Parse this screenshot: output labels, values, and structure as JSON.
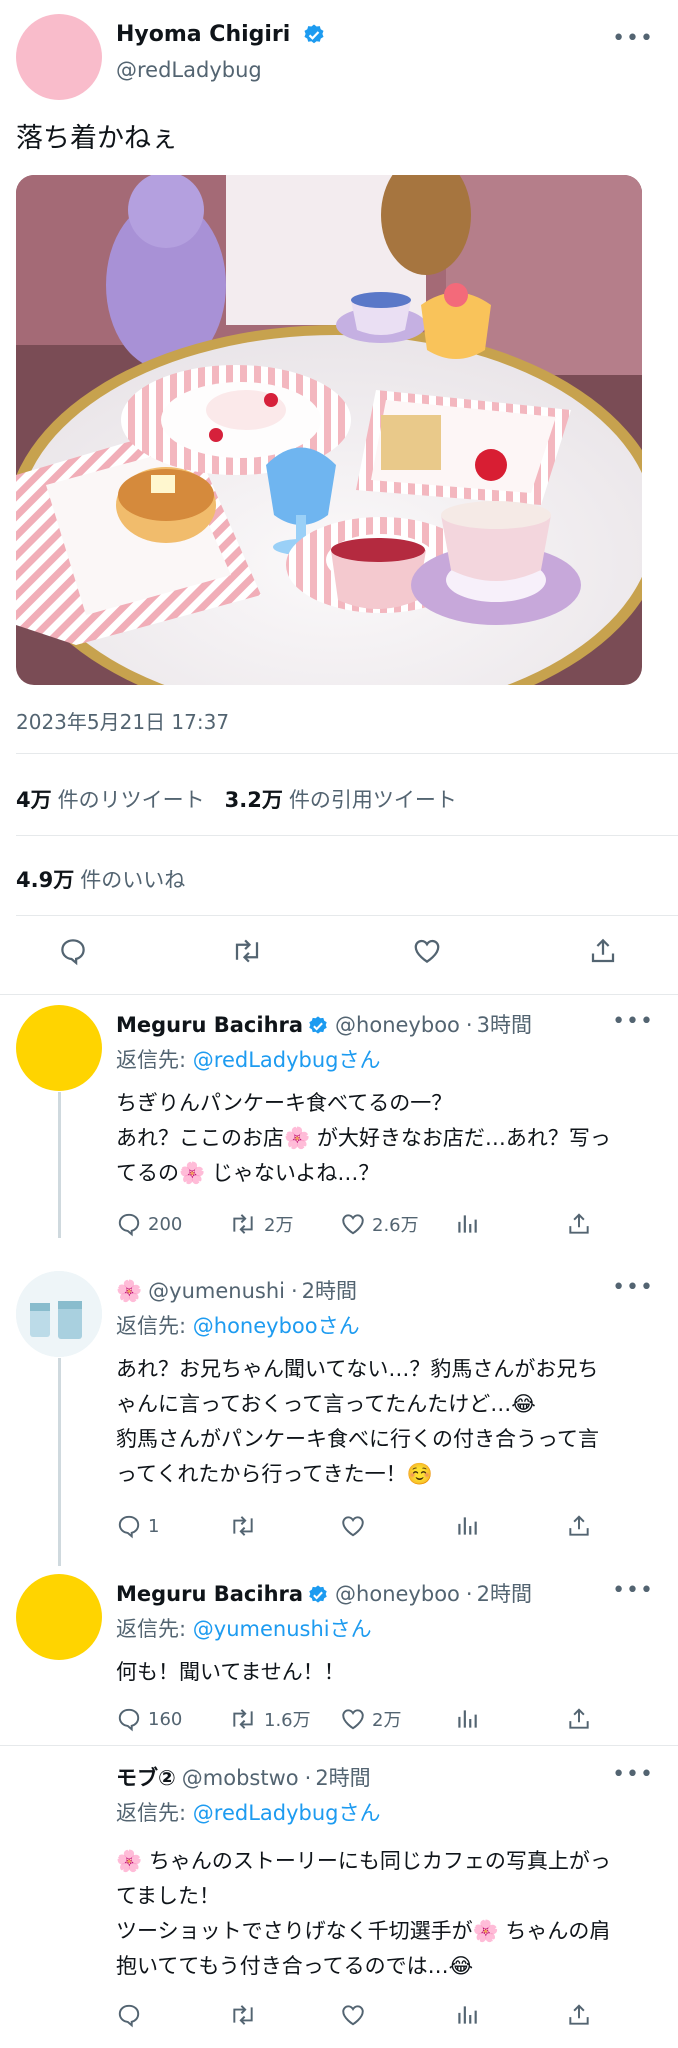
{
  "main_tweet": {
    "display_name": "Hyoma Chigiri",
    "handle": "@redLadybug",
    "text": "落ち着かねぇ",
    "datetime": "2023年5月21日 17:37",
    "retweets_count": "4万",
    "retweets_label": "件のリツイート",
    "quotes_count": "3.2万",
    "quotes_label": "件の引用ツイート",
    "likes_count": "4.9万",
    "likes_label": "件のいいね",
    "avatar_color": "#f9bccb"
  },
  "replies": [
    {
      "display_name": "Meguru Bacihra",
      "handle": "@honeyboo",
      "time": "3時間",
      "replying_prefix": "返信先: ",
      "replying_to": "@redLadybugさん",
      "lines": [
        "ちぎりんパンケーキ食べてるの一？",
        "あれ？ここのお店🌸 が大好きなお店だ…あれ？写っ",
        "てるの🌸 じゃないよね…？"
      ],
      "replies": "200",
      "retweets": "2万",
      "likes": "2.6万",
      "avatar_color": "#ffd400"
    },
    {
      "display_name": "🌸",
      "handle": "@yumenushi",
      "time": "2時間",
      "replying_prefix": "返信先: ",
      "replying_to": "@honeybooさん",
      "lines": [
        "あれ？お兄ちゃん聞いてない…？豹馬さんがお兄ち",
        "ゃんに言っておくって言ってたんたけど…😂",
        "豹馬さんがパンケーキ食べに行くの付き合うって言",
        "ってくれたから行ってきた一！☺️"
      ],
      "replies": "1",
      "retweets": "",
      "likes": "",
      "avatar_color": "#dfeef5"
    },
    {
      "display_name": "Meguru Bacihra",
      "handle": "@honeyboo",
      "time": "2時間",
      "replying_prefix": "返信先: ",
      "replying_to": "@yumenushiさん",
      "lines": [
        "何も！聞いてません！！"
      ],
      "replies": "160",
      "retweets": "1.6万",
      "likes": "2万",
      "avatar_color": "#ffd400"
    },
    {
      "display_name": "モブ②",
      "handle": "@mobstwo",
      "time": "2時間",
      "replying_prefix": "返信先: ",
      "replying_to": "@redLadybugさん",
      "lines": [
        "🌸 ちゃんのストーリーにも同じカフェの写真上がっ",
        "てました！",
        "ツーショットでさりげなく千切選手が🌸 ちゃんの肩",
        "抱いててもう付き合ってるのでは…😂"
      ],
      "replies": "",
      "retweets": "",
      "likes": "",
      "avatar_color": "#ffffff"
    }
  ],
  "meta_separator": "·",
  "colors": {
    "accent": "#1d9bf0",
    "secondary_text": "#536471",
    "divider": "#e6e9eb"
  }
}
